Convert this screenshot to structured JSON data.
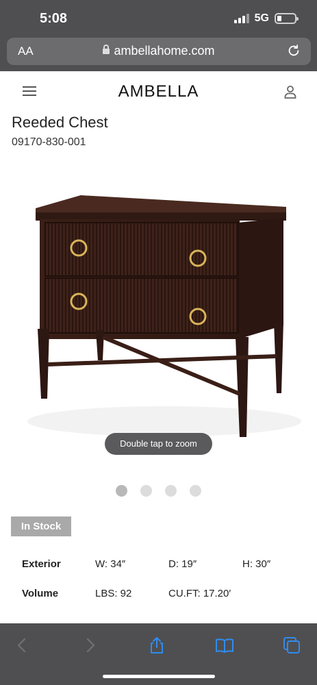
{
  "status_bar": {
    "time": "5:08",
    "network": "5G"
  },
  "browser": {
    "text_size_label": "AA",
    "url": "ambellahome.com"
  },
  "site": {
    "logo": "AMBELLA"
  },
  "product": {
    "title": "Reeded Chest",
    "sku": "09170-830-001",
    "zoom_hint": "Double tap to zoom",
    "image_count": 4,
    "active_image": 1,
    "stock_status": "In Stock"
  },
  "specs": [
    {
      "label": "Exterior",
      "values": [
        "W: 34″",
        "D: 19″",
        "H: 30″"
      ]
    },
    {
      "label": "Volume",
      "values": [
        "LBS: 92",
        "CU.FT: 17.20′",
        ""
      ]
    }
  ],
  "colors": {
    "chrome": "#4f4f51",
    "accent": "#1a73e8",
    "wood": "#3d211a",
    "brass": "#d9b45a"
  },
  "toolbar": {
    "items": [
      "back-icon",
      "forward-icon",
      "share-icon",
      "bookmarks-icon",
      "tabs-icon"
    ]
  }
}
